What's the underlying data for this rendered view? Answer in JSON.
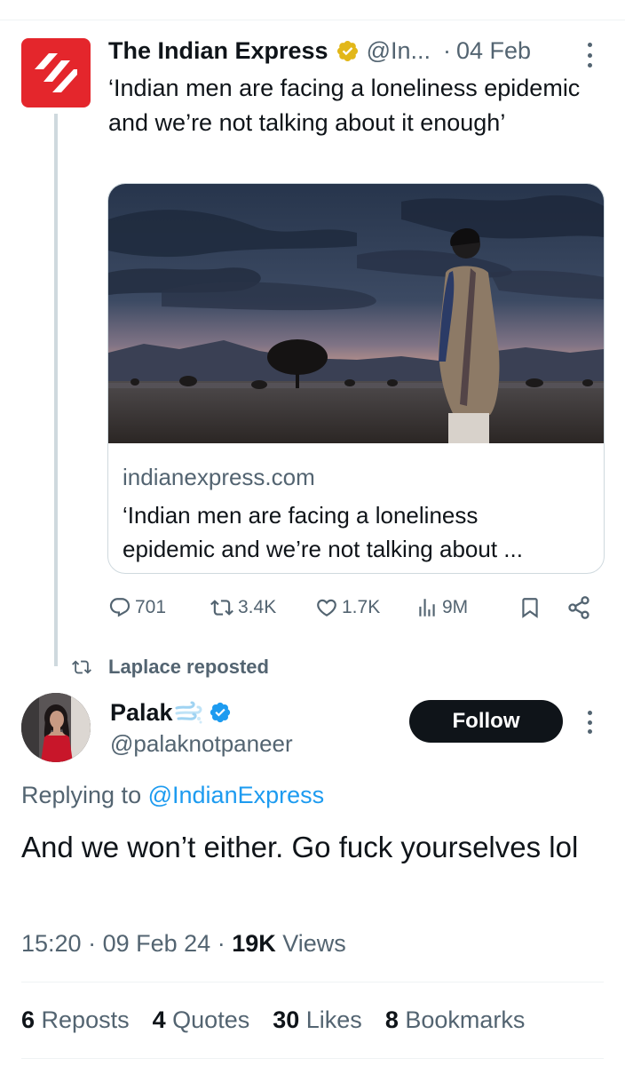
{
  "quoted_tweet": {
    "author_name": "The Indian Express",
    "handle": "@In...",
    "date": "04 Feb",
    "text": "‘Indian men are facing a loneliness epidemic and we’re not talking about it enough’",
    "card": {
      "domain": "indianexpress.com",
      "title": "‘Indian men are facing a loneliness\nepidemic and we’re not talking about ..."
    },
    "actions": {
      "replies": "701",
      "reposts": "3.4K",
      "likes": "1.7K",
      "views": "9M"
    }
  },
  "repost_context": {
    "label": "Laplace reposted"
  },
  "main_tweet": {
    "author_name": "Palak",
    "handle": "@palaknotpaneer",
    "follow_label": "Follow",
    "replying_prefix": "Replying to",
    "replying_to": "@IndianExpress",
    "text": "And we won’t either. Go fuck yourselves lol",
    "time": "15:20",
    "date": "09 Feb 24",
    "views_count": "19K",
    "views_label": "Views",
    "stats": [
      {
        "count": "6",
        "label": "Reposts"
      },
      {
        "count": "4",
        "label": "Quotes"
      },
      {
        "count": "30",
        "label": "Likes"
      },
      {
        "count": "8",
        "label": "Bookmarks"
      }
    ]
  },
  "icons": {
    "verified_gold": "verified-gold-badge-icon",
    "verified_blue": "verified-blue-badge-icon",
    "reply": "reply-icon",
    "repost": "repost-icon",
    "like": "heart-icon",
    "views": "views-bar-icon",
    "bookmark": "bookmark-icon",
    "share": "share-icon",
    "more": "more-vertical-icon"
  },
  "colors": {
    "text_primary": "#0f1419",
    "text_secondary": "#536471",
    "link": "#1d9bf0",
    "brand_red": "#e4262c",
    "verified_gold": "#e2b719",
    "verified_blue": "#1d9bf0",
    "divider": "#eff3f4"
  }
}
